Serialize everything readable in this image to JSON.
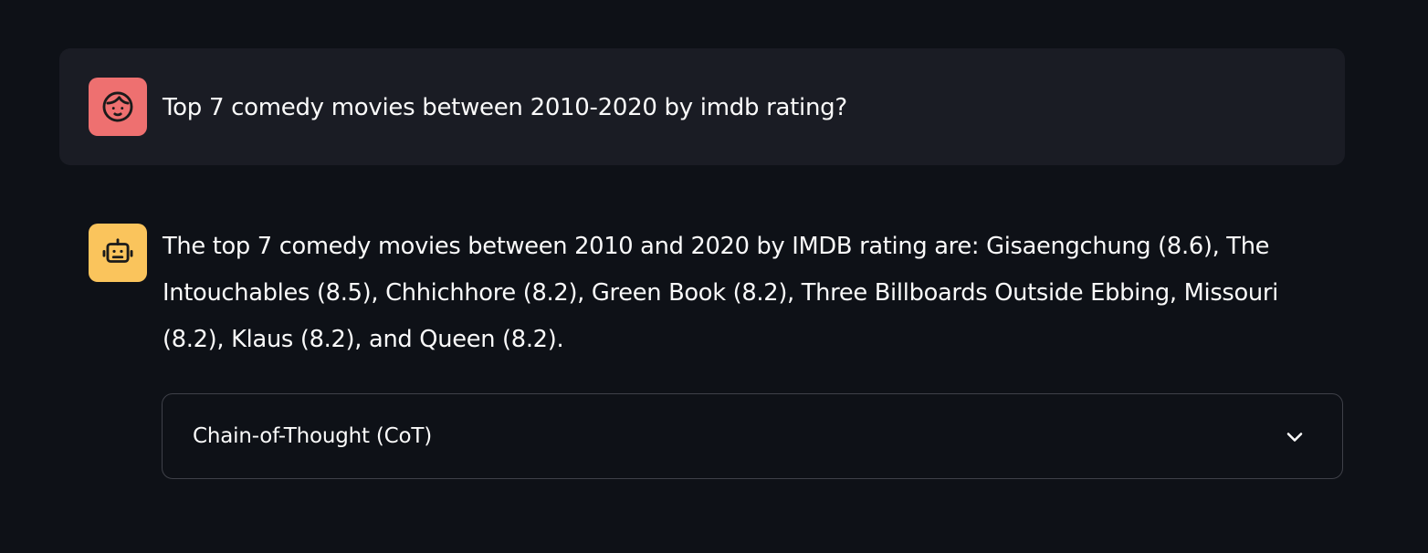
{
  "chat": {
    "user_message": {
      "avatar_icon": "user-face-icon",
      "avatar_color": "#ee7070",
      "text": "Top 7 comedy movies between 2010-2020 by imdb rating?"
    },
    "assistant_message": {
      "avatar_icon": "robot-icon",
      "avatar_color": "#fac45c",
      "text": "The top 7 comedy movies between 2010 and 2020 by IMDB rating are: Gisaengchung (8.6), The Intouchables (8.5), Chhichhore (8.2), Green Book (8.2), Three Billboards Outside Ebbing, Missouri (8.2), Klaus (8.2), and Queen (8.2)."
    },
    "expander": {
      "label": "Chain-of-Thought (CoT)",
      "icon": "chevron-down-icon",
      "expanded": false
    }
  },
  "colors": {
    "background": "#0e1117",
    "user_bubble": "#1a1c24",
    "text": "#fafafa",
    "border": "#3f4149"
  }
}
